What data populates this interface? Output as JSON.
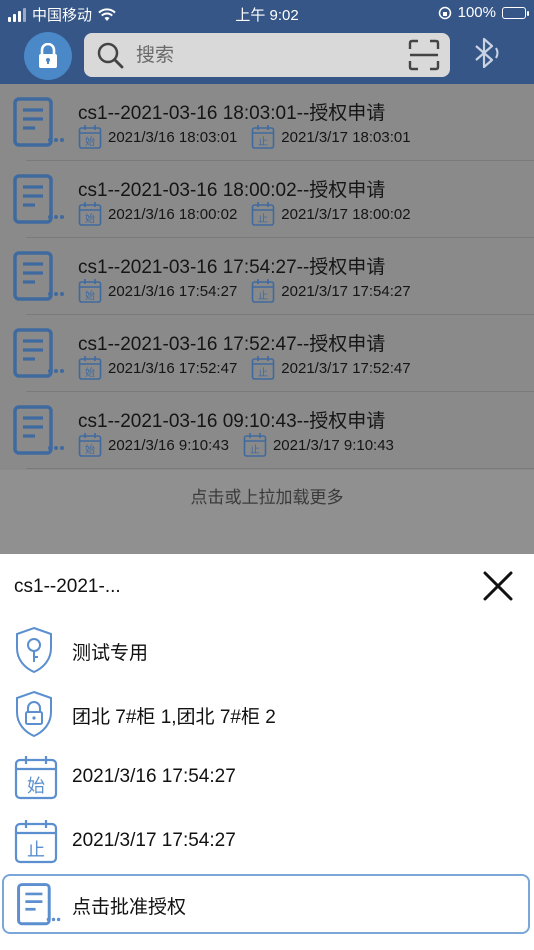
{
  "status_bar": {
    "carrier": "中国移动",
    "time": "上午 9:02",
    "battery": "100%"
  },
  "search": {
    "placeholder": "搜索"
  },
  "list": [
    {
      "title": "cs1--2021-03-16 18:03:01--授权申请",
      "start": "2021/3/16 18:03:01",
      "end": "2021/3/17 18:03:01"
    },
    {
      "title": "cs1--2021-03-16 18:00:02--授权申请",
      "start": "2021/3/16 18:00:02",
      "end": "2021/3/17 18:00:02"
    },
    {
      "title": "cs1--2021-03-16 17:54:27--授权申请",
      "start": "2021/3/16 17:54:27",
      "end": "2021/3/17 17:54:27"
    },
    {
      "title": "cs1--2021-03-16 17:52:47--授权申请",
      "start": "2021/3/16 17:52:47",
      "end": "2021/3/17 17:52:47"
    },
    {
      "title": "cs1--2021-03-16 09:10:43--授权申请",
      "start": "2021/3/16 9:10:43",
      "end": "2021/3/17 9:10:43"
    }
  ],
  "calendar_labels": {
    "start": "始",
    "end": "止"
  },
  "load_more": "点击或上拉加载更多",
  "sheet": {
    "title": "cs1--2021-...",
    "purpose": "测试专用",
    "locks": "团北 7#柜 1,团北 7#柜 2",
    "start_time": "2021/3/16 17:54:27",
    "end_time": "2021/3/17 17:54:27",
    "approve": "点击批准授权"
  },
  "colors": {
    "header": "#355687",
    "accent": "#4a88c8",
    "icon_blue": "#5b8fcf"
  }
}
